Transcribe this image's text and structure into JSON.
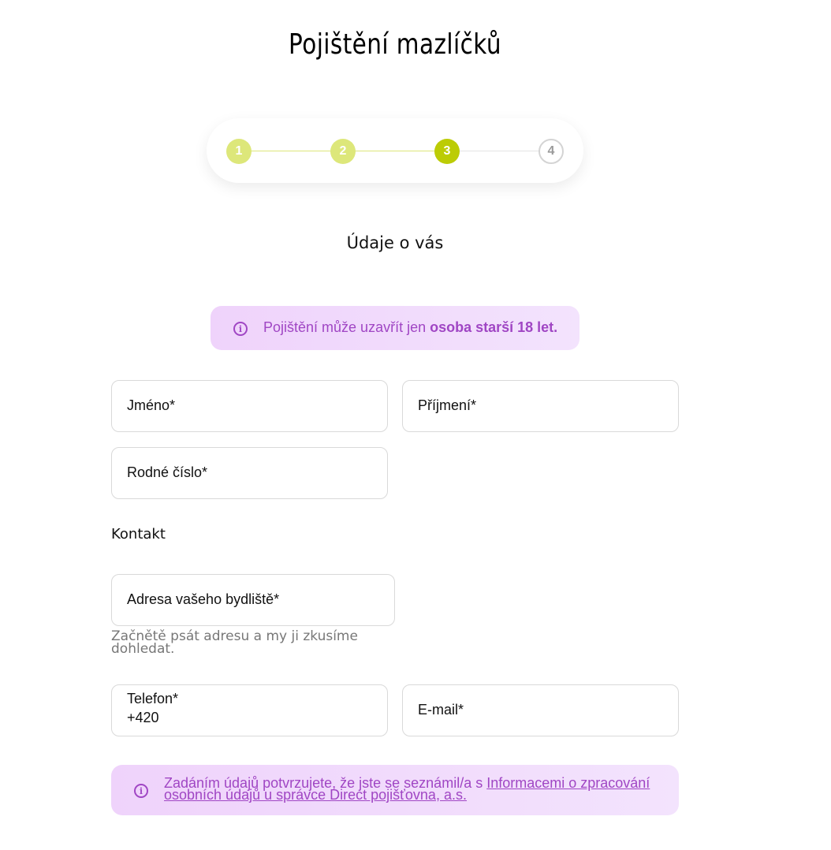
{
  "header": {
    "title": "Pojištění mazlíčků"
  },
  "stepper": {
    "steps": [
      {
        "label": "1",
        "state": "done"
      },
      {
        "label": "2",
        "state": "done"
      },
      {
        "label": "3",
        "state": "active"
      },
      {
        "label": "4",
        "state": "pending"
      }
    ],
    "colors": {
      "done": "#dde77a",
      "active": "#bccc05",
      "pending_border": "#d4d4d4",
      "pending_text": "#9a9a9a"
    }
  },
  "section": {
    "title": "Údaje o vás"
  },
  "age_notice": {
    "text_regular": "Pojištění může uzavřít jen ",
    "text_bold": "osoba starší 18 let."
  },
  "form": {
    "first_name_label": "Jméno*",
    "last_name_label": "Příjmení*",
    "birth_number_label": "Rodné číslo*",
    "contact_heading": "Kontakt",
    "address_label": "Adresa vašeho bydliště*",
    "address_hint": "Začnětě psát adresu a my ji zkusíme dohledat.",
    "phone_label": "Telefon*",
    "phone_value": "+420",
    "email_label": "E-mail*"
  },
  "consent": {
    "text_prefix": "Zadáním údajů potvrzujete, že jste se seznámil/a s ",
    "link_text": "Informacemi o zpracování osobních údajů u správce Direct pojišťovna, a.s."
  },
  "colors": {
    "accent_purple": "#a046c4",
    "info_bg": "#efd3fb"
  }
}
